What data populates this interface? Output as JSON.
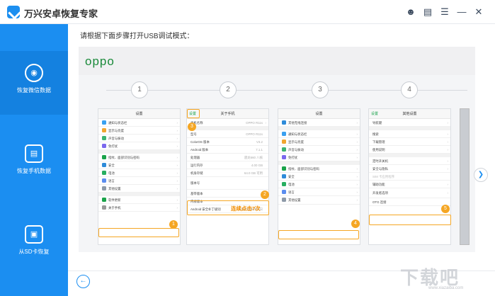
{
  "app": {
    "title": "万兴安卓恢复专家"
  },
  "titlebar_icons": [
    "user-icon",
    "book-icon",
    "menu-icon",
    "minimize-icon",
    "close-icon"
  ],
  "sidebar": {
    "items": [
      {
        "label": "恢复微信数据",
        "icon": "wechat-icon"
      },
      {
        "label": "恢复手机数据",
        "icon": "phone-data-icon"
      },
      {
        "label": "从SD卡恢复",
        "icon": "sd-card-icon"
      }
    ]
  },
  "main": {
    "instruction": "请根据下面步骤打开USB调试模式：",
    "brand": "oppo",
    "steps": [
      "1",
      "2",
      "3",
      "4"
    ],
    "tap_hint": "连续点击7次"
  },
  "phones": [
    {
      "title": "设置",
      "rows": [
        "通知与状态栏",
        "显示与亮度",
        "声音与振动",
        "免打扰",
        "",
        "指纹、面部识别与密码",
        "安全",
        "电池",
        "语言",
        "其他设置",
        "",
        "软件更新",
        "关于手机"
      ],
      "badge": "1"
    },
    {
      "title": "关于手机",
      "back": "设置",
      "rows": [
        "手机名称",
        "",
        "型号",
        "ColorOS 版本",
        "Android 版本",
        "处理器",
        "运行内存",
        "机身存储",
        "版本号",
        "基带版本",
        "内核版本",
        "Android 安全补丁级别"
      ],
      "values": [
        "OPPO R11s",
        "",
        "OPPO R11s",
        "V3.2",
        "7.1.1",
        "骁龙660 八核",
        "4.00 GB",
        "64.0 GB 可用",
        "",
        "",
        "",
        "2017年09月05日"
      ],
      "badges": [
        "3",
        "2"
      ]
    },
    {
      "title": "设置",
      "rows": [
        "其他无线连接",
        "",
        "通知与状态栏",
        "显示与亮度",
        "声音与振动",
        "免打扰",
        "",
        "指纹、面部识别与密码",
        "安全",
        "电池",
        "语言",
        "其他设置"
      ],
      "badge": "4"
    },
    {
      "title": "其他设置",
      "back": "设置",
      "rows": [
        "导航键",
        "",
        "搜索",
        "下载管理",
        "使用说明",
        "",
        "定时开关机",
        "安全与隐私",
        "SIM 卡应用程序",
        "辅助功能",
        "开发者选项",
        "OTG 连接"
      ],
      "badge": "5"
    }
  ],
  "watermark": {
    "text": "下载吧",
    "url": "www.xiazaiba.com"
  },
  "colors": {
    "sidebar": "#1b8ef1",
    "accent": "#f5a623",
    "oppo_green": "#1a8a3a"
  }
}
